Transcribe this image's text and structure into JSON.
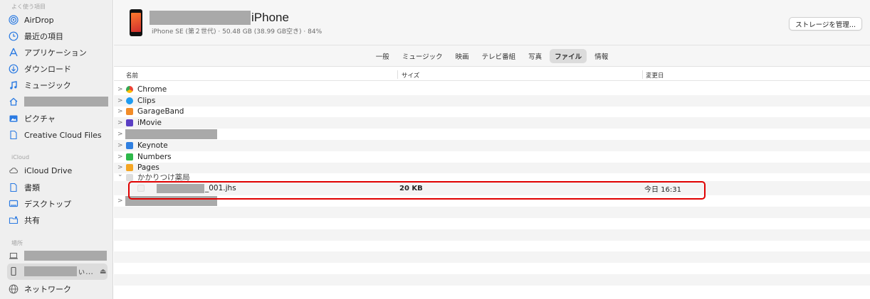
{
  "sidebar": {
    "favorites_heading": "よく使う項目",
    "icloud_heading": "iCloud",
    "places_heading": "場所",
    "items": [
      {
        "label": "AirDrop",
        "icon": "airdrop-icon"
      },
      {
        "label": "最近の項目",
        "icon": "clock-icon"
      },
      {
        "label": "アプリケーション",
        "icon": "applications-icon"
      },
      {
        "label": "ダウンロード",
        "icon": "download-icon"
      },
      {
        "label": "ミュージック",
        "icon": "music-icon"
      },
      {
        "label": "",
        "icon": "home-icon"
      },
      {
        "label": "ピクチャ",
        "icon": "pictures-icon"
      },
      {
        "label": "Creative Cloud Files",
        "icon": "document-icon"
      }
    ],
    "icloud_items": [
      {
        "label": "iCloud Drive",
        "icon": "cloud-icon"
      },
      {
        "label": "書類",
        "icon": "document-icon"
      },
      {
        "label": "デスクトップ",
        "icon": "desktop-icon"
      },
      {
        "label": "共有",
        "icon": "shared-folder-icon"
      }
    ],
    "places_items": [
      {
        "label": "",
        "icon": "laptop-icon"
      },
      {
        "label": "ぃ…",
        "icon": "iphone-icon"
      },
      {
        "label": "ネットワーク",
        "icon": "network-icon"
      }
    ],
    "eject_glyph": "⏏"
  },
  "device": {
    "name_suffix": "iPhone",
    "subtitle": "iPhone SE (第２世代) · 50.48 GB (38.99 GB空き) · 84%",
    "manage_button": "ストレージを管理..."
  },
  "tabs": [
    "一般",
    "ミュージック",
    "映画",
    "テレビ番組",
    "写真",
    "ファイル",
    "情報"
  ],
  "active_tab": "ファイル",
  "columns": {
    "name": "名前",
    "size": "サイズ",
    "modified": "変更日"
  },
  "rows": [
    {
      "name": "Chrome",
      "chevron": ">",
      "color": "#4285f4"
    },
    {
      "name": "Clips",
      "chevron": ">",
      "color": "#1e9bf0"
    },
    {
      "name": "GarageBand",
      "chevron": ">",
      "color": "#f28c28"
    },
    {
      "name": "iMovie",
      "chevron": ">",
      "color": "#5b3fc4"
    },
    {
      "name": "",
      "chevron": ">",
      "color": ""
    },
    {
      "name": "Keynote",
      "chevron": ">",
      "color": "#2f7fe0"
    },
    {
      "name": "Numbers",
      "chevron": ">",
      "color": "#2eb84a"
    },
    {
      "name": "Pages",
      "chevron": ">",
      "color": "#f5a623"
    },
    {
      "name": "かかりつけ薬局",
      "chevron": "⌄",
      "color": "#bbbbbb"
    },
    {
      "name": "_001.jhs",
      "size": "20 KB",
      "modified": "今日 16:31",
      "chevron": "",
      "color": "#e8e8e8"
    },
    {
      "name": "",
      "chevron": ">",
      "color": ""
    }
  ]
}
